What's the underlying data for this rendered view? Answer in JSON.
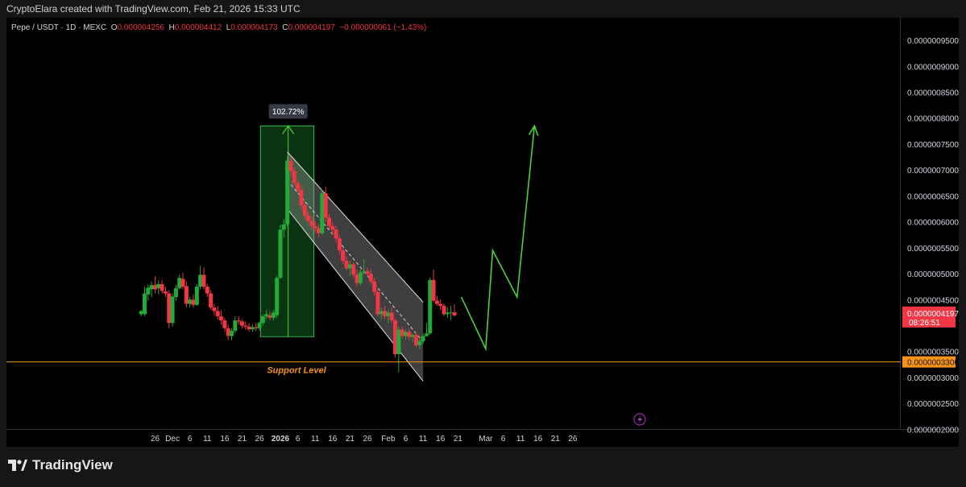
{
  "header": {
    "attribution": "CryptoElara created with TradingView.com, Feb 21, 2026 15:33 UTC"
  },
  "legend": {
    "symbol": "Pepe / USDT · 1D · MEXC",
    "o_label": "O",
    "o_value": "0.000004256",
    "h_label": "H",
    "h_value": "0.000004412",
    "l_label": "L",
    "l_value": "0.000004173",
    "c_label": "C",
    "c_value": "0.000004197",
    "change": "−0.000000061 (−1.43%)"
  },
  "price_axis": {
    "ticks": [
      "0.0000009500",
      "0.0000009000",
      "0.0000008500",
      "0.0000008000",
      "0.0000007500",
      "0.0000007000",
      "0.0000006500",
      "0.0000006000",
      "0.0000005500",
      "0.0000005000",
      "0.0000004500",
      "0.0000003500",
      "0.0000003000",
      "0.0000002500",
      "0.0000002000"
    ],
    "current_price": "0.0000004197",
    "countdown": "08:26:51",
    "support_price": "0.0000003300"
  },
  "time_axis": {
    "labels": [
      "26",
      "Dec",
      "6",
      "11",
      "16",
      "21",
      "26",
      "2026",
      "6",
      "11",
      "16",
      "21",
      "26",
      "Feb",
      "6",
      "11",
      "16",
      "21",
      "Mar",
      "6",
      "11",
      "16",
      "21",
      "26"
    ]
  },
  "annotations": {
    "measure_label": "102.72%",
    "support_label": "Support Level"
  },
  "footer": {
    "brand": "TradingView"
  },
  "colors": {
    "up": "#22ab38",
    "down": "#f23645",
    "support": "#f7931a",
    "projection": "#4cd137",
    "channel_fill": "#5a5a5a"
  },
  "chart_data": {
    "type": "candlestick",
    "timeframe": "1D",
    "symbol": "PEPE/USDT",
    "exchange": "MEXC",
    "ylim": [
      2e-07,
      9.8e-07
    ],
    "support_level": 3.3e-07,
    "candles": [
      {
        "date": "2025-11-22",
        "o": 4.22e-07,
        "h": 4.3e-07,
        "l": 4.18e-07,
        "c": 4.28e-07
      },
      {
        "date": "2025-11-23",
        "o": 4.22e-07,
        "h": 4.75e-07,
        "l": 4.18e-07,
        "c": 4.62e-07
      },
      {
        "date": "2025-11-24",
        "o": 4.6e-07,
        "h": 4.8e-07,
        "l": 4.48e-07,
        "c": 4.73e-07
      },
      {
        "date": "2025-11-25",
        "o": 4.7e-07,
        "h": 4.85e-07,
        "l": 4.55e-07,
        "c": 4.78e-07
      },
      {
        "date": "2025-11-26",
        "o": 4.78e-07,
        "h": 4.95e-07,
        "l": 4.62e-07,
        "c": 4.7e-07
      },
      {
        "date": "2025-11-27",
        "o": 4.72e-07,
        "h": 4.88e-07,
        "l": 4.6e-07,
        "c": 4.8e-07
      },
      {
        "date": "2025-11-28",
        "o": 4.8e-07,
        "h": 4.88e-07,
        "l": 4.62e-07,
        "c": 4.67e-07
      },
      {
        "date": "2025-11-29",
        "o": 4.66e-07,
        "h": 4.75e-07,
        "l": 4.55e-07,
        "c": 4.62e-07
      },
      {
        "date": "2025-11-30",
        "o": 4.62e-07,
        "h": 4.68e-07,
        "l": 3.95e-07,
        "c": 4.05e-07
      },
      {
        "date": "2025-12-01",
        "o": 4.05e-07,
        "h": 4.62e-07,
        "l": 3.98e-07,
        "c": 4.56e-07
      },
      {
        "date": "2025-12-02",
        "o": 4.55e-07,
        "h": 4.78e-07,
        "l": 4.48e-07,
        "c": 4.72e-07
      },
      {
        "date": "2025-12-03",
        "o": 4.72e-07,
        "h": 4.98e-07,
        "l": 4.7e-07,
        "c": 4.92e-07
      },
      {
        "date": "2025-12-04",
        "o": 4.9e-07,
        "h": 5.02e-07,
        "l": 4.7e-07,
        "c": 4.75e-07
      },
      {
        "date": "2025-12-05",
        "o": 4.76e-07,
        "h": 4.85e-07,
        "l": 4.35e-07,
        "c": 4.42e-07
      },
      {
        "date": "2025-12-06",
        "o": 4.42e-07,
        "h": 4.55e-07,
        "l": 4.35e-07,
        "c": 4.5e-07
      },
      {
        "date": "2025-12-07",
        "o": 4.5e-07,
        "h": 4.6e-07,
        "l": 4.35e-07,
        "c": 4.4e-07
      },
      {
        "date": "2025-12-08",
        "o": 4.4e-07,
        "h": 4.8e-07,
        "l": 4.38e-07,
        "c": 4.75e-07
      },
      {
        "date": "2025-12-09",
        "o": 4.75e-07,
        "h": 5.15e-07,
        "l": 4.7e-07,
        "c": 4.98e-07
      },
      {
        "date": "2025-12-10",
        "o": 4.98e-07,
        "h": 5.12e-07,
        "l": 4.7e-07,
        "c": 4.75e-07
      },
      {
        "date": "2025-12-11",
        "o": 4.75e-07,
        "h": 4.8e-07,
        "l": 4.55e-07,
        "c": 4.62e-07
      },
      {
        "date": "2025-12-12",
        "o": 4.62e-07,
        "h": 4.68e-07,
        "l": 4.3e-07,
        "c": 4.35e-07
      },
      {
        "date": "2025-12-13",
        "o": 4.35e-07,
        "h": 4.42e-07,
        "l": 4.2e-07,
        "c": 4.28e-07
      },
      {
        "date": "2025-12-14",
        "o": 4.28e-07,
        "h": 4.38e-07,
        "l": 4.12e-07,
        "c": 4.18e-07
      },
      {
        "date": "2025-12-15",
        "o": 4.18e-07,
        "h": 4.3e-07,
        "l": 4.02e-07,
        "c": 4.1e-07
      },
      {
        "date": "2025-12-16",
        "o": 4.1e-07,
        "h": 4.15e-07,
        "l": 3.88e-07,
        "c": 3.95e-07
      },
      {
        "date": "2025-12-17",
        "o": 3.95e-07,
        "h": 4.02e-07,
        "l": 3.72e-07,
        "c": 3.8e-07
      },
      {
        "date": "2025-12-18",
        "o": 3.8e-07,
        "h": 3.95e-07,
        "l": 3.72e-07,
        "c": 3.9e-07
      },
      {
        "date": "2025-12-19",
        "o": 3.9e-07,
        "h": 4.18e-07,
        "l": 3.85e-07,
        "c": 4.1e-07
      },
      {
        "date": "2025-12-20",
        "o": 4.1e-07,
        "h": 4.18e-07,
        "l": 4.02e-07,
        "c": 4.08e-07
      },
      {
        "date": "2025-12-21",
        "o": 4.08e-07,
        "h": 4.12e-07,
        "l": 3.95e-07,
        "c": 4e-07
      },
      {
        "date": "2025-12-22",
        "o": 4e-07,
        "h": 4.08e-07,
        "l": 3.92e-07,
        "c": 3.98e-07
      },
      {
        "date": "2025-12-23",
        "o": 3.98e-07,
        "h": 4.05e-07,
        "l": 3.88e-07,
        "c": 3.93e-07
      },
      {
        "date": "2025-12-24",
        "o": 3.93e-07,
        "h": 4.02e-07,
        "l": 3.88e-07,
        "c": 3.97e-07
      },
      {
        "date": "2025-12-25",
        "o": 3.97e-07,
        "h": 4.05e-07,
        "l": 3.9e-07,
        "c": 3.95e-07
      },
      {
        "date": "2025-12-26",
        "o": 3.95e-07,
        "h": 4.08e-07,
        "l": 3.9e-07,
        "c": 4.05e-07
      },
      {
        "date": "2025-12-27",
        "o": 4.05e-07,
        "h": 4.22e-07,
        "l": 4e-07,
        "c": 4.18e-07
      },
      {
        "date": "2025-12-28",
        "o": 4.18e-07,
        "h": 4.3e-07,
        "l": 4.12e-07,
        "c": 4.22e-07
      },
      {
        "date": "2025-12-29",
        "o": 4.2e-07,
        "h": 4.28e-07,
        "l": 4.1e-07,
        "c": 4.15e-07
      },
      {
        "date": "2025-12-30",
        "o": 4.15e-07,
        "h": 4.3e-07,
        "l": 4.1e-07,
        "c": 4.25e-07
      },
      {
        "date": "2025-12-31",
        "o": 4.2e-07,
        "h": 4.95e-07,
        "l": 4.15e-07,
        "c": 4.92e-07
      },
      {
        "date": "2026-01-01",
        "o": 4.92e-07,
        "h": 5.95e-07,
        "l": 4.9e-07,
        "c": 5.85e-07
      },
      {
        "date": "2026-01-02",
        "o": 5.85e-07,
        "h": 6.05e-07,
        "l": 5.7e-07,
        "c": 5.95e-07
      },
      {
        "date": "2026-01-03",
        "o": 5.95e-07,
        "h": 7.25e-07,
        "l": 5.92e-07,
        "c": 7.18e-07
      },
      {
        "date": "2026-01-04",
        "o": 7.18e-07,
        "h": 7.25e-07,
        "l": 6.9e-07,
        "c": 6.98e-07
      },
      {
        "date": "2026-01-05",
        "o": 6.98e-07,
        "h": 7.05e-07,
        "l": 6.7e-07,
        "c": 6.75e-07
      },
      {
        "date": "2026-01-06",
        "o": 6.75e-07,
        "h": 6.82e-07,
        "l": 6.55e-07,
        "c": 6.62e-07
      },
      {
        "date": "2026-01-07",
        "o": 6.62e-07,
        "h": 6.7e-07,
        "l": 6.25e-07,
        "c": 6.32e-07
      },
      {
        "date": "2026-01-08",
        "o": 6.32e-07,
        "h": 6.4e-07,
        "l": 6.05e-07,
        "c": 6.12e-07
      },
      {
        "date": "2026-01-09",
        "o": 6.12e-07,
        "h": 6.2e-07,
        "l": 5.98e-07,
        "c": 6.02e-07
      },
      {
        "date": "2026-01-10",
        "o": 6.02e-07,
        "h": 6.12e-07,
        "l": 5.85e-07,
        "c": 5.92e-07
      },
      {
        "date": "2026-01-11",
        "o": 5.92e-07,
        "h": 6.02e-07,
        "l": 5.8e-07,
        "c": 5.88e-07
      },
      {
        "date": "2026-01-12",
        "o": 5.88e-07,
        "h": 5.95e-07,
        "l": 5.7e-07,
        "c": 5.78e-07
      },
      {
        "date": "2026-01-13",
        "o": 5.78e-07,
        "h": 6.62e-07,
        "l": 5.75e-07,
        "c": 6.55e-07
      },
      {
        "date": "2026-01-14",
        "o": 6.55e-07,
        "h": 6.68e-07,
        "l": 6e-07,
        "c": 6.08e-07
      },
      {
        "date": "2026-01-15",
        "o": 6.08e-07,
        "h": 6.15e-07,
        "l": 5.85e-07,
        "c": 5.92e-07
      },
      {
        "date": "2026-01-16",
        "o": 5.92e-07,
        "h": 6e-07,
        "l": 5.75e-07,
        "c": 5.85e-07
      },
      {
        "date": "2026-01-17",
        "o": 5.85e-07,
        "h": 5.92e-07,
        "l": 5.6e-07,
        "c": 5.68e-07
      },
      {
        "date": "2026-01-18",
        "o": 5.68e-07,
        "h": 5.75e-07,
        "l": 5.38e-07,
        "c": 5.45e-07
      },
      {
        "date": "2026-01-19",
        "o": 5.45e-07,
        "h": 5.5e-07,
        "l": 5.18e-07,
        "c": 5.25e-07
      },
      {
        "date": "2026-01-20",
        "o": 5.25e-07,
        "h": 5.35e-07,
        "l": 5.05e-07,
        "c": 5.1e-07
      },
      {
        "date": "2026-01-21",
        "o": 5.1e-07,
        "h": 5.25e-07,
        "l": 4.95e-07,
        "c": 5.18e-07
      },
      {
        "date": "2026-01-22",
        "o": 5.18e-07,
        "h": 5.22e-07,
        "l": 4.92e-07,
        "c": 4.98e-07
      },
      {
        "date": "2026-01-23",
        "o": 4.98e-07,
        "h": 5.08e-07,
        "l": 4.75e-07,
        "c": 4.82e-07
      },
      {
        "date": "2026-01-24",
        "o": 4.82e-07,
        "h": 5.08e-07,
        "l": 4.78e-07,
        "c": 5.02e-07
      },
      {
        "date": "2026-01-25",
        "o": 5.02e-07,
        "h": 5.28e-07,
        "l": 4.98e-07,
        "c": 5.05e-07
      },
      {
        "date": "2026-01-26",
        "o": 5.05e-07,
        "h": 5.12e-07,
        "l": 4.95e-07,
        "c": 5e-07
      },
      {
        "date": "2026-01-27",
        "o": 5e-07,
        "h": 5.08e-07,
        "l": 4.8e-07,
        "c": 4.85e-07
      },
      {
        "date": "2026-01-28",
        "o": 4.85e-07,
        "h": 4.92e-07,
        "l": 4.58e-07,
        "c": 4.65e-07
      },
      {
        "date": "2026-01-29",
        "o": 4.65e-07,
        "h": 4.7e-07,
        "l": 4.18e-07,
        "c": 4.22e-07
      },
      {
        "date": "2026-01-30",
        "o": 4.22e-07,
        "h": 4.35e-07,
        "l": 4.12e-07,
        "c": 4.28e-07
      },
      {
        "date": "2026-01-31",
        "o": 4.28e-07,
        "h": 4.38e-07,
        "l": 4.12e-07,
        "c": 4.18e-07
      },
      {
        "date": "2026-02-01",
        "o": 4.18e-07,
        "h": 4.3e-07,
        "l": 4.05e-07,
        "c": 4.25e-07
      },
      {
        "date": "2026-02-02",
        "o": 4.25e-07,
        "h": 4.35e-07,
        "l": 4.05e-07,
        "c": 4.1e-07
      },
      {
        "date": "2026-02-03",
        "o": 4.1e-07,
        "h": 4.15e-07,
        "l": 3.38e-07,
        "c": 3.45e-07
      },
      {
        "date": "2026-02-04",
        "o": 3.45e-07,
        "h": 3.98e-07,
        "l": 3.1e-07,
        "c": 3.92e-07
      },
      {
        "date": "2026-02-05",
        "o": 3.92e-07,
        "h": 3.98e-07,
        "l": 3.75e-07,
        "c": 3.8e-07
      },
      {
        "date": "2026-02-06",
        "o": 3.8e-07,
        "h": 3.92e-07,
        "l": 3.72e-07,
        "c": 3.88e-07
      },
      {
        "date": "2026-02-07",
        "o": 3.88e-07,
        "h": 3.95e-07,
        "l": 3.72e-07,
        "c": 3.78e-07
      },
      {
        "date": "2026-02-08",
        "o": 3.78e-07,
        "h": 3.85e-07,
        "l": 3.68e-07,
        "c": 3.82e-07
      },
      {
        "date": "2026-02-09",
        "o": 3.82e-07,
        "h": 3.86e-07,
        "l": 3.58e-07,
        "c": 3.62e-07
      },
      {
        "date": "2026-02-10",
        "o": 3.62e-07,
        "h": 3.75e-07,
        "l": 3.55e-07,
        "c": 3.7e-07
      },
      {
        "date": "2026-02-11",
        "o": 3.7e-07,
        "h": 3.85e-07,
        "l": 3.65e-07,
        "c": 3.8e-07
      },
      {
        "date": "2026-02-12",
        "o": 3.8e-07,
        "h": 4.05e-07,
        "l": 3.78e-07,
        "c": 3.85e-07
      },
      {
        "date": "2026-02-13",
        "o": 3.85e-07,
        "h": 4.92e-07,
        "l": 3.82e-07,
        "c": 4.88e-07
      },
      {
        "date": "2026-02-14",
        "o": 4.88e-07,
        "h": 5.08e-07,
        "l": 4.45e-07,
        "c": 4.48e-07
      },
      {
        "date": "2026-02-15",
        "o": 4.48e-07,
        "h": 4.58e-07,
        "l": 4.38e-07,
        "c": 4.42e-07
      },
      {
        "date": "2026-02-16",
        "o": 4.42e-07,
        "h": 4.5e-07,
        "l": 4.3e-07,
        "c": 4.38e-07
      },
      {
        "date": "2026-02-17",
        "o": 4.38e-07,
        "h": 4.42e-07,
        "l": 4.18e-07,
        "c": 4.22e-07
      },
      {
        "date": "2026-02-18",
        "o": 4.22e-07,
        "h": 4.35e-07,
        "l": 4.15e-07,
        "c": 4.25e-07
      },
      {
        "date": "2026-02-19",
        "o": 4.25e-07,
        "h": 4.38e-07,
        "l": 4.1e-07,
        "c": 4.26e-07
      },
      {
        "date": "2026-02-20",
        "o": 4.256e-07,
        "h": 4.412e-07,
        "l": 4.173e-07,
        "c": 4.197e-07
      }
    ],
    "measure": {
      "from_date": "2025-12-30",
      "to_date": "2026-01-06",
      "from_price": 3.88e-07,
      "to_price": 7.85e-07,
      "label": "102.72%"
    },
    "channel": {
      "upper": [
        [
          "2026-01-03",
          7.35e-07
        ],
        [
          "2026-02-11",
          4.45e-07
        ]
      ],
      "lower": [
        [
          "2026-01-03",
          6.25e-07
        ],
        [
          "2026-02-11",
          2.93e-07
        ]
      ]
    },
    "projection": [
      [
        "2026-02-22",
        4.55e-07
      ],
      [
        "2026-03-01",
        3.55e-07
      ],
      [
        "2026-03-03",
        5.45e-07
      ],
      [
        "2026-03-10",
        4.55e-07
      ],
      [
        "2026-03-15",
        7.85e-07
      ]
    ]
  }
}
